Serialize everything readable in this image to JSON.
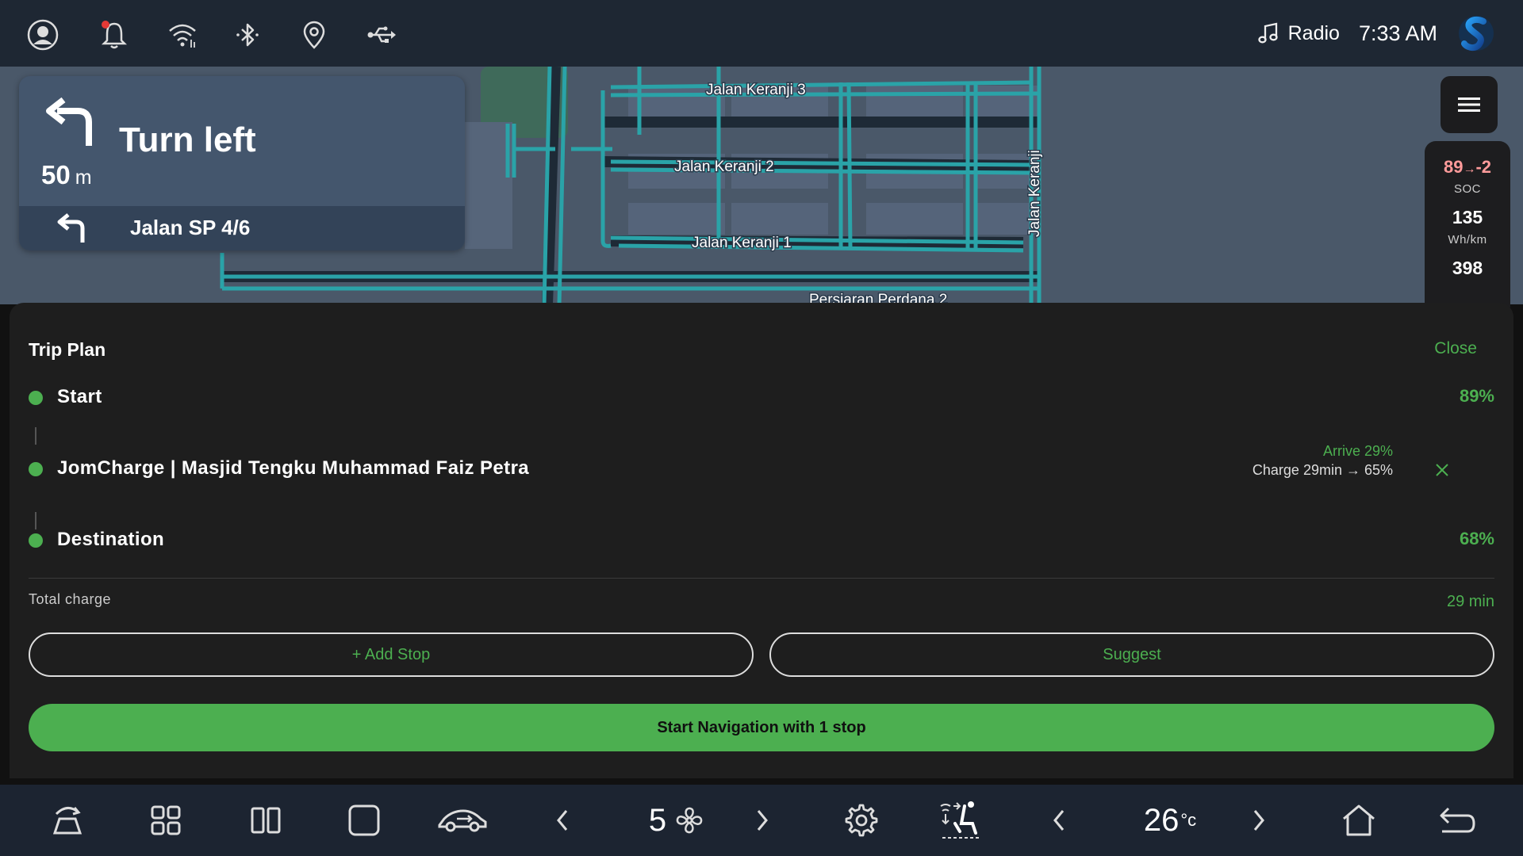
{
  "status_bar": {
    "icons": [
      "account-icon",
      "notification-bell-icon",
      "wifi-icon",
      "bluetooth-icon",
      "location-pin-icon",
      "usb-icon"
    ],
    "media_source": "Radio",
    "time": "7:33 AM"
  },
  "map": {
    "streets": [
      "Jalan Keranji 3",
      "Jalan Keranji 2",
      "Jalan Keranji 1",
      "Jalan Keranji",
      "Persiaran Perdana 2"
    ]
  },
  "navigation": {
    "instruction": "Turn left",
    "distance": "50",
    "distance_unit": "m",
    "next_street": "Jalan SP 4/6"
  },
  "stats": {
    "soc_from": "89",
    "soc_arrow": "→",
    "soc_to": "-2",
    "soc_label": "SOC",
    "consumption": "135",
    "consumption_unit": "Wh/km",
    "range": "398"
  },
  "trip_plan": {
    "title": "Trip Plan",
    "close_label": "Close",
    "start": {
      "name": "Start",
      "percent": "89%"
    },
    "stop": {
      "name": "JomCharge | Masjid Tengku Muhammad Faiz Petra",
      "arrive": "Arrive 29%",
      "charge": "Charge 29min → 65%"
    },
    "destination": {
      "name": "Destination",
      "percent": "68%"
    },
    "total_charge_label": "Total charge",
    "total_charge_value": "29 min",
    "add_stop_label": "+ Add Stop",
    "suggest_label": "Suggest",
    "start_nav_label": "Start Navigation with 1 stop"
  },
  "dock": {
    "fan_speed": "5",
    "temperature": "26",
    "temperature_unit": "°c"
  },
  "colors": {
    "accent": "#4caf50",
    "soc_warning": "#ff9b9b",
    "map_road": "#2aa3a8",
    "status_bar_bg": "#1e2733",
    "panel_bg": "#1e1e1e"
  }
}
